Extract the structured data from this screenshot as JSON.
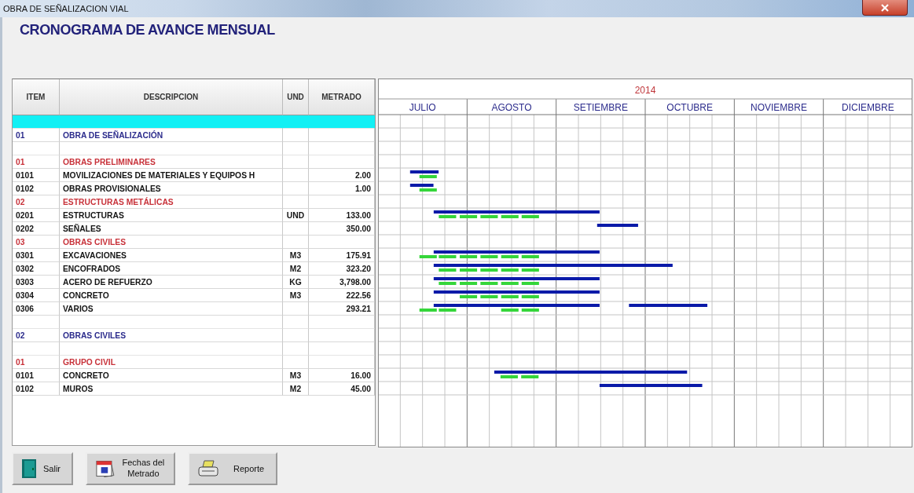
{
  "window": {
    "title": "OBRA DE SEÑALIZACION VIAL"
  },
  "heading": "CRONOGRAMA DE AVANCE MENSUAL",
  "table": {
    "columns": [
      "ITEM",
      "DESCRIPCION",
      "UND",
      "METRADO"
    ],
    "rows": [
      {
        "kind": "blank",
        "selected": true
      },
      {
        "kind": "group",
        "selected": false,
        "item": "01",
        "description": "OBRA DE SEÑALIZACIÓN"
      },
      {
        "kind": "blank",
        "selected": false
      },
      {
        "kind": "subgroup",
        "selected": false,
        "item": "01",
        "description": "OBRAS PRELIMINARES"
      },
      {
        "kind": "item",
        "selected": false,
        "item": "0101",
        "description": "MOVILIZACIONES DE MATERIALES Y EQUIPOS H",
        "quantity": "2.00"
      },
      {
        "kind": "item",
        "selected": false,
        "item": "0102",
        "description": "OBRAS PROVISIONALES",
        "quantity": "1.00"
      },
      {
        "kind": "subgroup",
        "selected": false,
        "item": "02",
        "description": "ESTRUCTURAS METÁLICAS"
      },
      {
        "kind": "item",
        "selected": false,
        "item": "0201",
        "description": "ESTRUCTURAS",
        "unit": "UND",
        "quantity": "133.00"
      },
      {
        "kind": "item",
        "selected": false,
        "item": "0202",
        "description": "SEÑALES",
        "quantity": "350.00"
      },
      {
        "kind": "subgroup",
        "selected": false,
        "item": "03",
        "description": "OBRAS CIVILES"
      },
      {
        "kind": "item",
        "selected": false,
        "item": "0301",
        "description": "EXCAVACIONES",
        "unit": "M3",
        "quantity": "175.91"
      },
      {
        "kind": "item",
        "selected": false,
        "item": "0302",
        "description": "ENCOFRADOS",
        "unit": "M2",
        "quantity": "323.20"
      },
      {
        "kind": "item",
        "selected": false,
        "item": "0303",
        "description": "ACERO DE REFUERZO",
        "unit": "KG",
        "quantity": "3,798.00"
      },
      {
        "kind": "item",
        "selected": false,
        "item": "0304",
        "description": "CONCRETO",
        "unit": "M3",
        "quantity": "222.56"
      },
      {
        "kind": "item",
        "selected": false,
        "item": "0306",
        "description": "VARIOS",
        "quantity": "293.21"
      },
      {
        "kind": "blank",
        "selected": false
      },
      {
        "kind": "group",
        "selected": false,
        "item": "02",
        "description": "OBRAS CIVILES"
      },
      {
        "kind": "blank",
        "selected": false
      },
      {
        "kind": "subgroup",
        "selected": false,
        "item": "01",
        "description": "GRUPO CIVIL"
      },
      {
        "kind": "item",
        "selected": false,
        "item": "0101",
        "description": "CONCRETO",
        "unit": "M3",
        "quantity": "16.00"
      },
      {
        "kind": "item",
        "selected": false,
        "item": "0102",
        "description": "MUROS",
        "unit": "M2",
        "quantity": "45.00"
      }
    ]
  },
  "gantt": {
    "year": "2014",
    "months": [
      "JULIO",
      "AGOSTO",
      "SETIEMBRE",
      "OCTUBRE",
      "NOVIEMBRE",
      "DICIEMBRE"
    ]
  },
  "buttons": [
    {
      "kind": "exit",
      "label": "Salir"
    },
    {
      "kind": "calendar",
      "label": "Fechas del Metrado"
    },
    {
      "kind": "print",
      "label": "Reporte"
    }
  ]
}
